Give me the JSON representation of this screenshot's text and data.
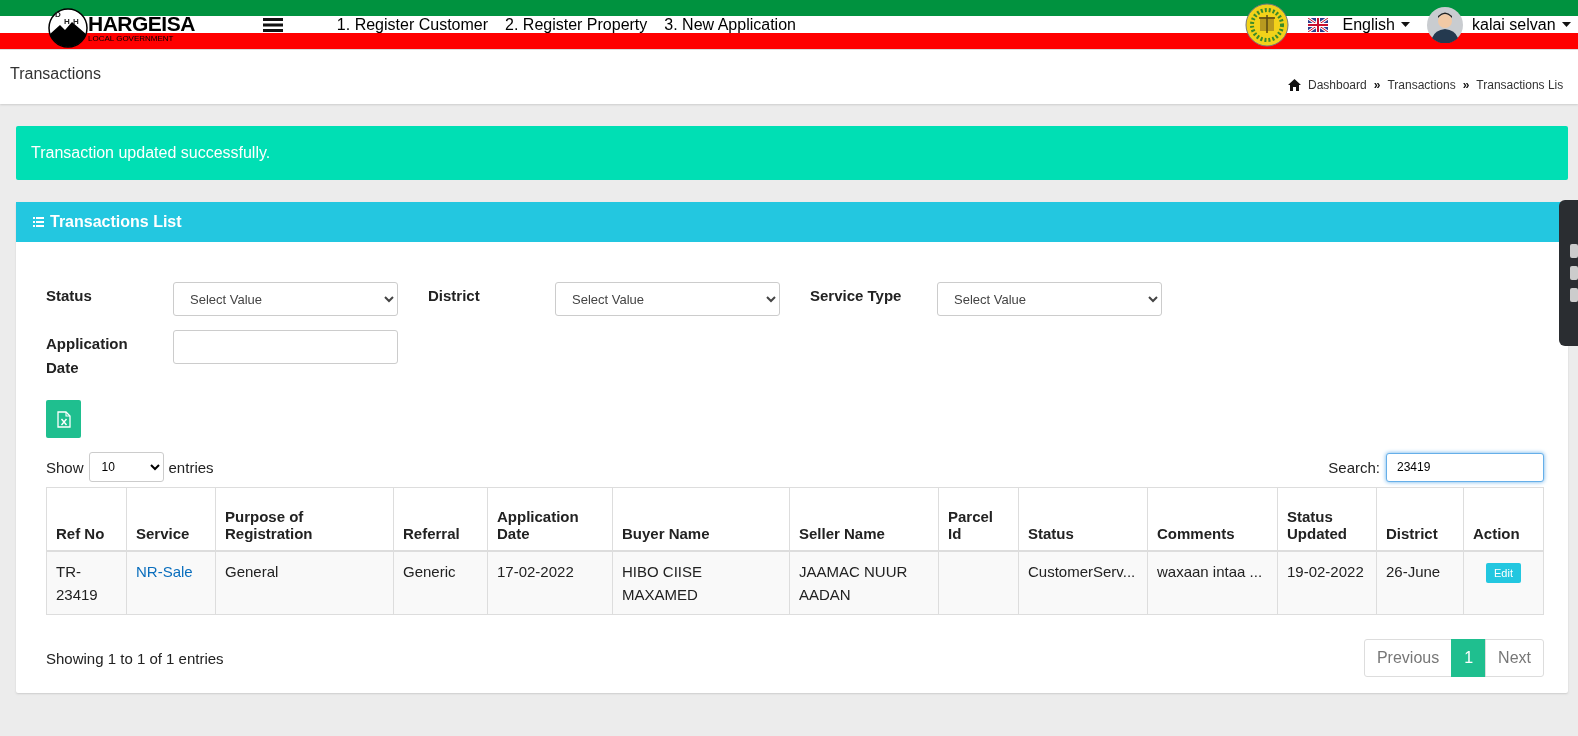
{
  "header": {
    "logo": {
      "title": "HARGEISA",
      "subtitle": "LOCAL GOVERNMENT",
      "letters": [
        "D",
        "H",
        "H"
      ]
    },
    "nav": [
      "1. Register Customer",
      "2. Register Property",
      "3. New Application"
    ],
    "language": "English",
    "user": "kalai selvan"
  },
  "page": {
    "title": "Transactions",
    "breadcrumb": [
      "Dashboard",
      "»",
      "Transactions",
      "»",
      "Transactions Lis"
    ]
  },
  "alert": "Transaction updated successfully.",
  "panel": {
    "title": "Transactions List",
    "filters": [
      {
        "label": "Status",
        "kind": "select",
        "value": "Select Value"
      },
      {
        "label": "District",
        "kind": "select",
        "value": "Select Value"
      },
      {
        "label": "Service Type",
        "kind": "select",
        "value": "Select Value"
      },
      {
        "label": "Application Date",
        "kind": "text"
      }
    ],
    "length": {
      "before": "Show",
      "value": "10",
      "after": "entries"
    },
    "search": {
      "label": "Search:",
      "value": "23419"
    },
    "table": {
      "columns": [
        "Ref No",
        "Service",
        "Purpose of Registration",
        "Referral",
        "Application Date",
        "Buyer Name",
        "Seller Name",
        "Parcel Id",
        "Status",
        "Comments",
        "Status Updated",
        "District",
        "Action"
      ],
      "rows": [
        {
          "cells": [
            "TR-23419",
            "NR-Sale",
            "General",
            "Generic",
            "17-02-2022",
            "HIBO CIISE MAXAMED",
            "JAAMAC NUUR AADAN",
            "",
            "CustomerServ...",
            "waxaan intaa ...",
            "19-02-2022",
            "26-June"
          ],
          "action": "Edit"
        }
      ]
    },
    "info": "Showing 1 to 1 of 1 entries",
    "pagination": [
      {
        "label": "Previous",
        "kind": "prev",
        "selected": false
      },
      {
        "label": "1",
        "kind": "page",
        "selected": true
      },
      {
        "label": "Next",
        "kind": "next",
        "selected": false
      }
    ]
  }
}
